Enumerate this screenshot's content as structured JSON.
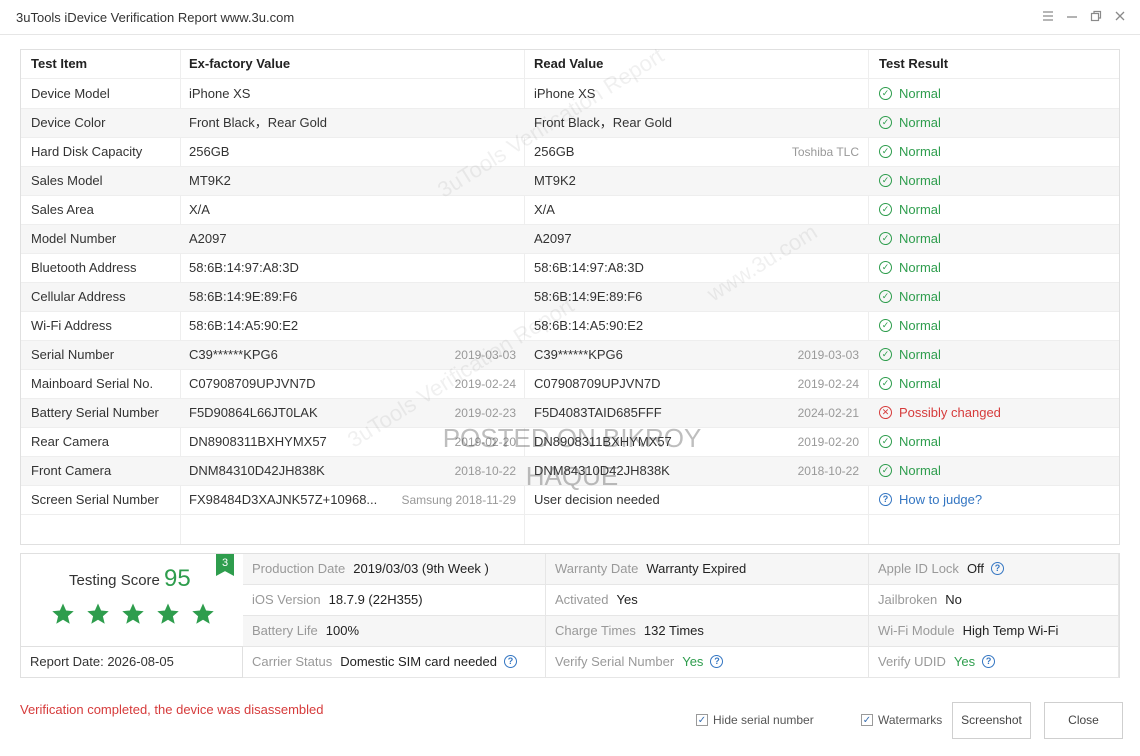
{
  "window": {
    "title": "3uTools iDevice Verification Report www.3u.com",
    "controls": [
      "menu-icon",
      "minimize-icon",
      "restore-icon",
      "close-icon"
    ]
  },
  "table": {
    "headers": [
      "Test Item",
      "Ex-factory Value",
      "Read Value",
      "Test Result"
    ],
    "rows": [
      {
        "item": "Device Model",
        "ex_value": "iPhone XS",
        "ex_date": "",
        "read_value": "iPhone XS",
        "read_date": "",
        "result": "Normal",
        "status": "ok"
      },
      {
        "item": "Device Color",
        "ex_value": "Front Black，Rear Gold",
        "ex_date": "",
        "read_value": "Front Black，Rear Gold",
        "read_date": "",
        "result": "Normal",
        "status": "ok"
      },
      {
        "item": "Hard Disk Capacity",
        "ex_value": "256GB",
        "ex_date": "",
        "read_value": "256GB",
        "read_date": "Toshiba TLC",
        "result": "Normal",
        "status": "ok"
      },
      {
        "item": "Sales Model",
        "ex_value": "MT9K2",
        "ex_date": "",
        "read_value": "MT9K2",
        "read_date": "",
        "result": "Normal",
        "status": "ok"
      },
      {
        "item": "Sales Area",
        "ex_value": "X/A",
        "ex_date": "",
        "read_value": "X/A",
        "read_date": "",
        "result": "Normal",
        "status": "ok"
      },
      {
        "item": "Model Number",
        "ex_value": "A2097",
        "ex_date": "",
        "read_value": "A2097",
        "read_date": "",
        "result": "Normal",
        "status": "ok"
      },
      {
        "item": "Bluetooth Address",
        "ex_value": "58:6B:14:97:A8:3D",
        "ex_date": "",
        "read_value": "58:6B:14:97:A8:3D",
        "read_date": "",
        "result": "Normal",
        "status": "ok"
      },
      {
        "item": "Cellular Address",
        "ex_value": "58:6B:14:9E:89:F6",
        "ex_date": "",
        "read_value": "58:6B:14:9E:89:F6",
        "read_date": "",
        "result": "Normal",
        "status": "ok"
      },
      {
        "item": "Wi-Fi Address",
        "ex_value": "58:6B:14:A5:90:E2",
        "ex_date": "",
        "read_value": "58:6B:14:A5:90:E2",
        "read_date": "",
        "result": "Normal",
        "status": "ok"
      },
      {
        "item": "Serial Number",
        "ex_value": "C39******KPG6",
        "ex_date": "2019-03-03",
        "read_value": "C39******KPG6",
        "read_date": "2019-03-03",
        "result": "Normal",
        "status": "ok"
      },
      {
        "item": "Mainboard Serial No.",
        "ex_value": "C07908709UPJVN7D",
        "ex_date": "2019-02-24",
        "read_value": "C07908709UPJVN7D",
        "read_date": "2019-02-24",
        "result": "Normal",
        "status": "ok"
      },
      {
        "item": "Battery Serial Number",
        "ex_value": "F5D90864L66JT0LAK",
        "ex_date": "2019-02-23",
        "read_value": "F5D4083TAID685FFF",
        "read_date": "2024-02-21",
        "result": "Possibly changed",
        "status": "bad"
      },
      {
        "item": "Rear Camera",
        "ex_value": "DN8908311BXHYMX57",
        "ex_date": "2019-02-20",
        "read_value": "DN8908311BXHYMX57",
        "read_date": "2019-02-20",
        "result": "Normal",
        "status": "ok"
      },
      {
        "item": "Front Camera",
        "ex_value": "DNM84310D42JH838K",
        "ex_date": "2018-10-22",
        "read_value": "DNM84310D42JH838K",
        "read_date": "2018-10-22",
        "result": "Normal",
        "status": "ok"
      },
      {
        "item": "Screen Serial Number",
        "ex_value": "FX98484D3XAJNK57Z+10968...",
        "ex_date": "Samsung 2018-11-29",
        "read_value": "User decision needed",
        "read_date": "",
        "result": "How to judge?",
        "status": "help"
      }
    ]
  },
  "summary": {
    "testing_score_label": "Testing Score",
    "testing_score": "95",
    "badge": "3",
    "stars": 5,
    "report_date": "Report Date:  2026-08-05",
    "fields": [
      {
        "label": "Production Date",
        "value": "2019/03/03 (9th Week )",
        "help": false,
        "green": false
      },
      {
        "label": "Warranty Date",
        "value": "Warranty Expired",
        "help": false,
        "green": false
      },
      {
        "label": "Apple ID Lock",
        "value": "Off",
        "help": true,
        "green": false
      },
      {
        "label": "iOS Version",
        "value": "18.7.9 (22H355)",
        "help": false,
        "green": false
      },
      {
        "label": "Activated",
        "value": "Yes",
        "help": false,
        "green": false
      },
      {
        "label": "Jailbroken",
        "value": "No",
        "help": false,
        "green": false
      },
      {
        "label": "Battery Life",
        "value": "100%",
        "help": false,
        "green": false
      },
      {
        "label": "Charge Times",
        "value": "132 Times",
        "help": false,
        "green": false
      },
      {
        "label": "Wi-Fi Module",
        "value": "High Temp Wi-Fi",
        "help": false,
        "green": false
      },
      {
        "label": "Carrier Status",
        "value": "Domestic SIM card needed",
        "help": true,
        "green": false
      },
      {
        "label": "Verify Serial Number",
        "value": "Yes",
        "help": true,
        "green": true
      },
      {
        "label": "Verify UDID",
        "value": "Yes",
        "help": true,
        "green": true
      }
    ]
  },
  "footer": {
    "status_message": "Verification completed, the device was disassembled",
    "hide_serial_label": "Hide serial number",
    "hide_serial_checked": true,
    "watermarks_label": "Watermarks",
    "watermarks_checked": true,
    "screenshot_label": "Screenshot",
    "close_label": "Close"
  },
  "overlay": {
    "posted_line1": "POSTED ON BIKROY",
    "posted_line2": "HAQUE"
  },
  "colors": {
    "ok": "#2e9d4d",
    "bad": "#d63b3b",
    "help": "#3476c2"
  }
}
